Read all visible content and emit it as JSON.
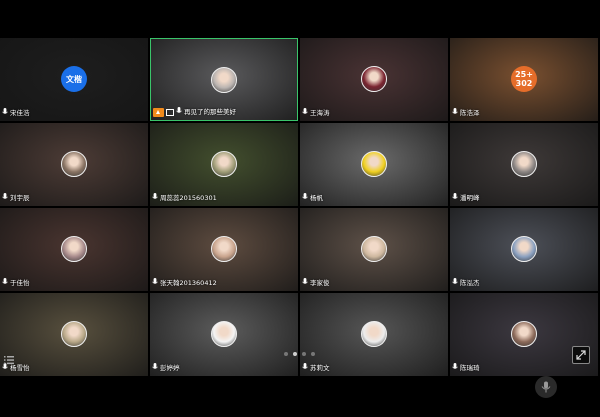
{
  "participants": [
    {
      "name": "宋佳浩",
      "avatar_text": "文楷",
      "bg": "#1e1e1e",
      "avatar_bg": "#1a6fe8",
      "avatar_type": "text"
    },
    {
      "name": "再见了的那些美好",
      "bg": "#5a5a5c",
      "avatar_bg": "#b9b3b0",
      "avatar_type": "photo",
      "active": true,
      "host": true
    },
    {
      "name": "王海涛",
      "bg": "#4a3334",
      "avatar_bg": "#7a2430",
      "avatar_type": "photo"
    },
    {
      "name": "陈浩泽",
      "avatar_text": "25+ 302",
      "bg": "#7a5030",
      "avatar_bg": "#e56d2a",
      "avatar_type": "text"
    },
    {
      "name": "刘宇辰",
      "bg": "#4d3c36",
      "avatar_bg": "#8a7464",
      "avatar_type": "photo"
    },
    {
      "name": "周蕊蕊201560301",
      "bg": "#434f2e",
      "avatar_bg": "#a09e78",
      "avatar_type": "photo"
    },
    {
      "name": "杨帆",
      "bg": "#6a6a6a",
      "avatar_bg": "#f0d020",
      "avatar_type": "photo"
    },
    {
      "name": "潘明峰",
      "bg": "#3e3938",
      "avatar_bg": "#8c8684",
      "avatar_type": "photo"
    },
    {
      "name": "于佳怡",
      "bg": "#4a3530",
      "avatar_bg": "#a6898a",
      "avatar_type": "photo"
    },
    {
      "name": "张天翰201360412",
      "bg": "#5e4c40",
      "avatar_bg": "#c8a38c",
      "avatar_type": "photo"
    },
    {
      "name": "李家俊",
      "bg": "#5e5148",
      "avatar_bg": "#cdb79e",
      "avatar_type": "photo"
    },
    {
      "name": "陈泓杰",
      "bg": "#4d5058",
      "avatar_bg": "#8aa0c0",
      "avatar_type": "photo"
    },
    {
      "name": "杨雪怡",
      "bg": "#58503e",
      "avatar_bg": "#b8a888",
      "avatar_type": "photo"
    },
    {
      "name": "彭婷婷",
      "bg": "#5c5c5c",
      "avatar_bg": "#f4f4f4",
      "avatar_type": "photo"
    },
    {
      "name": "苏莉文",
      "bg": "#565656",
      "avatar_bg": "#ededed",
      "avatar_type": "photo"
    },
    {
      "name": "陈瑞琦",
      "bg": "#3c3840",
      "avatar_bg": "#8c6a5a",
      "avatar_type": "photo"
    }
  ],
  "pagination": {
    "pages": 4,
    "current": 2
  },
  "colors": {
    "active_border": "#3ac46a",
    "host_badge": "#f08a1c"
  }
}
